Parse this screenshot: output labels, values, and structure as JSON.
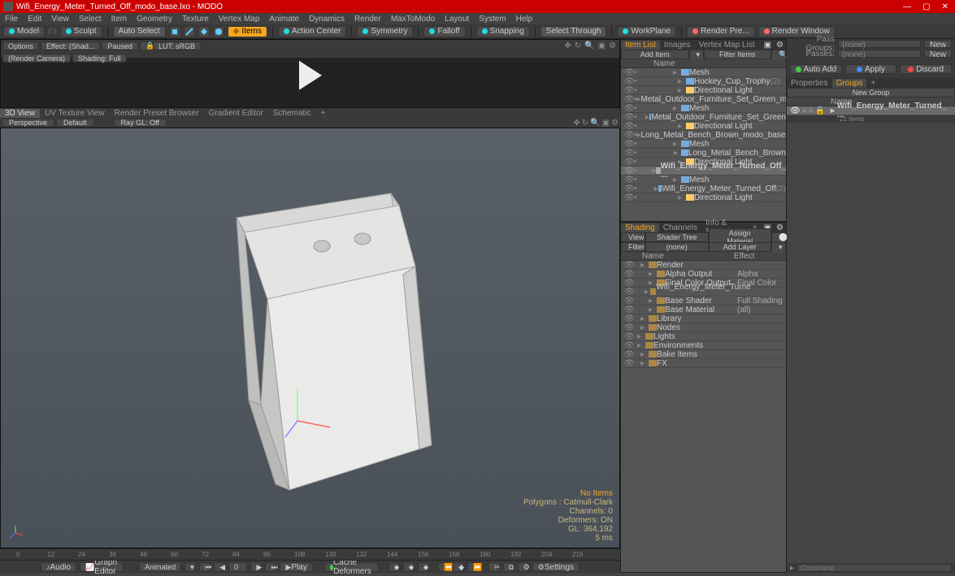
{
  "titlebar": {
    "title": "Wifi_Energy_Meter_Turned_Off_modo_base.lxo - MODO"
  },
  "menu": [
    "File",
    "Edit",
    "View",
    "Select",
    "Item",
    "Geometry",
    "Texture",
    "Vertex Map",
    "Animate",
    "Dynamics",
    "Render",
    "MaxToModo",
    "Layout",
    "System",
    "Help"
  ],
  "toolbar": {
    "model": "Model",
    "sculpt": "Sculpt",
    "autoselect": "Auto Select",
    "items": "Items",
    "actioncenter": "Action Center",
    "symmetry": "Symmetry",
    "falloff": "Falloff",
    "snapping": "Snapping",
    "selectthrough": "Select Through",
    "workplane": "WorkPlane",
    "renderprev": "Render Pre...",
    "renderwindow": "Render Window"
  },
  "render_opts": {
    "options": "Options",
    "effect": "Effect: (Shad...",
    "paused": "Paused",
    "lut": "LUT: sRGB",
    "camera": "(Render Camera)",
    "shading": "Shading: Full"
  },
  "view_tabs": [
    "3D View",
    "UV Texture View",
    "Render Preset Browser",
    "Gradient Editor",
    "Schematic"
  ],
  "view_opts": {
    "perspective": "Perspective",
    "default": "Default",
    "raygl": "Ray GL: Off"
  },
  "vp_stats": {
    "noitems": "No Items",
    "polys": "Polygons : Catmull-Clark",
    "channels": "Channels: 0",
    "deformers": "Deformers: ON",
    "gl": "GL: 364,192",
    "ms": "5 ms"
  },
  "timeline": {
    "ticks": [
      "0",
      "12",
      "24",
      "36",
      "48",
      "60",
      "72",
      "84",
      "96",
      "108",
      "120",
      "132",
      "144",
      "156",
      "168",
      "180",
      "192",
      "204",
      "216"
    ],
    "audio": "Audio",
    "graph": "Graph Editor",
    "animated": "Animated",
    "frame": "0",
    "play": "Play",
    "cache": "Cache Deformers",
    "settings": "Settings"
  },
  "itemlist": {
    "tabs": [
      "Item List",
      "Images",
      "Vertex Map List"
    ],
    "add": "Add Item",
    "filter": "Filter Items",
    "hdr_name": "Name",
    "rows": [
      {
        "indent": 36,
        "icon": "mesh",
        "label": "Mesh"
      },
      {
        "indent": 42,
        "icon": "mesh",
        "label": "Hockey_Cup_Trophy",
        "suffix": "(2)"
      },
      {
        "indent": 42,
        "icon": "light",
        "label": "Directional Light"
      },
      {
        "indent": 30,
        "icon": "loc",
        "label": "Metal_Outdoor_Furniture_Set_Green_m..."
      },
      {
        "indent": 36,
        "icon": "mesh",
        "label": "Mesh"
      },
      {
        "indent": 42,
        "icon": "mesh",
        "label": "Metal_Outdoor_Furniture_Set_Green"
      },
      {
        "indent": 42,
        "icon": "light",
        "label": "Directional Light"
      },
      {
        "indent": 30,
        "icon": "loc",
        "label": "Long_Metal_Bench_Brown_modo_base.lxo"
      },
      {
        "indent": 36,
        "icon": "mesh",
        "label": "Mesh"
      },
      {
        "indent": 42,
        "icon": "mesh",
        "label": "Long_Metal_Bench_Brown"
      },
      {
        "indent": 42,
        "icon": "light",
        "label": "Directional Light"
      },
      {
        "indent": 30,
        "icon": "loc",
        "label": "Wifi_Energy_Meter_Turned_Off_ ...",
        "selected": true
      },
      {
        "indent": 36,
        "icon": "mesh",
        "label": "Mesh"
      },
      {
        "indent": 42,
        "icon": "mesh",
        "label": "Wifi_Energy_Meter_Turned_Off",
        "suffix": "(2)"
      },
      {
        "indent": 42,
        "icon": "light",
        "label": "Directional Light"
      }
    ]
  },
  "shading": {
    "tabs": [
      "Shading",
      "Channels",
      "Info & Statistics"
    ],
    "view": "View",
    "shadertree": "Shader Tree",
    "assign": "Assign Material",
    "filter": "Filter",
    "none": "(none)",
    "addlayer": "Add Layer",
    "hdr_name": "Name",
    "hdr_effect": "Effect",
    "rows": [
      {
        "indent": 8,
        "label": "Render",
        "effect": ""
      },
      {
        "indent": 18,
        "label": "Alpha Output",
        "effect": "Alpha"
      },
      {
        "indent": 18,
        "label": "Final Color Output",
        "effect": "Final Color"
      },
      {
        "indent": 18,
        "label": "Wifi_Energy_Meter_Turne ...",
        "effect": ""
      },
      {
        "indent": 18,
        "label": "Base Shader",
        "effect": "Full Shading"
      },
      {
        "indent": 18,
        "label": "Base Material",
        "effect": "(all)"
      },
      {
        "indent": 8,
        "label": "Library",
        "effect": ""
      },
      {
        "indent": 8,
        "label": "Nodes",
        "effect": ""
      },
      {
        "indent": 4,
        "label": "Lights",
        "effect": ""
      },
      {
        "indent": 4,
        "label": "Environments",
        "effect": ""
      },
      {
        "indent": 8,
        "label": "Bake Items",
        "effect": ""
      },
      {
        "indent": 8,
        "label": "FX",
        "effect": ""
      }
    ]
  },
  "passes": {
    "groups_label": "Pass Groups:",
    "groups_val": "(none)",
    "new": "New",
    "passes_label": "Passes:",
    "passes_val": "(none)"
  },
  "actions": {
    "autoadd": "Auto Add",
    "apply": "Apply",
    "discard": "Discard"
  },
  "props_tabs": [
    "Properties",
    "Groups"
  ],
  "newgroup": "New Group",
  "groups_hdr": "Name",
  "groups_item": "Wifi_Energy_Meter_Turned_ ...",
  "groups_count": "21 Items",
  "command": "Command",
  "render_window_btn": "Render Window"
}
